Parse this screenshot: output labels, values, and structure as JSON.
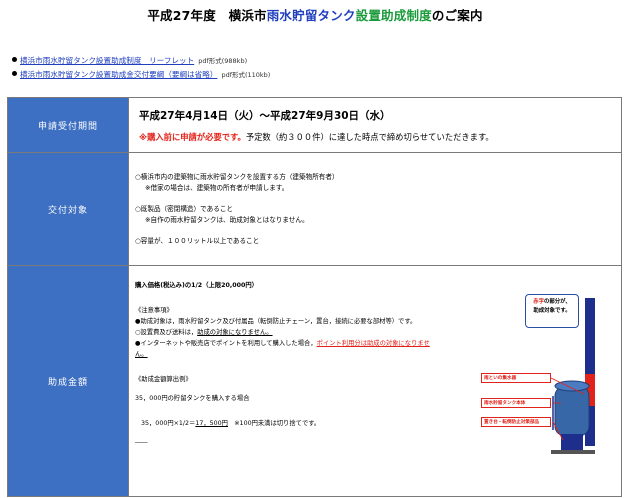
{
  "title": {
    "part1": "平成27年度　横浜市",
    "part2": "雨水貯留タンク",
    "part3": "設置助成制度",
    "part4": "のご案内"
  },
  "links": [
    {
      "text": "横浜市雨水貯留タンク設置助成制度　リーフレット",
      "format": "pdf形式(988kb)"
    },
    {
      "text": "横浜市雨水貯留タンク設置助成金交付要綱（要綱は省略）",
      "format": "pdf形式(110kb)"
    }
  ],
  "rows": {
    "application": {
      "label": "申請受付期間",
      "period": "平成27年4月14日（火）〜平成27年9月30日（水）",
      "note_red": "※購入前に申請が必要です。",
      "note_rest": "予定数（約３００件）に達した時点で締め切らせていただきます。"
    },
    "eligibility": {
      "label": "交付対象",
      "lines": [
        "○横浜市内の建築物に雨水貯留タンクを設置する方（建築物所有者）",
        "※借家の場合は、建築物の所有者が申請します。",
        "○既製品（密閉構造）であること",
        "※自作の雨水貯留タンクは、助成対象とはなりません。",
        "○容量が、１００リットル以上であること"
      ]
    },
    "grant": {
      "label": "助成金額",
      "headline": "購入価格(税込み)の1/2（上限20,000円）",
      "notes_title": "《注意事項》",
      "note1": "●助成対象は，雨水貯留タンク及び付属品（転倒防止チェーン，置台，接続に必要な部材等）です。",
      "note2_a": "○設置費及び送料は，",
      "note2_b": "助成の対象になりません。",
      "note3_a": "●インターネットや販売店でポイントを利用して購入した場合，",
      "note3_b": "ポイント利用分は助成の対象になりませ",
      "note3_c": "ん。",
      "calc_title": "《助成金額算出例》",
      "calc_case": "35，000円の貯留タンクを購入する場合",
      "calc_a": "35，000円×1/2＝",
      "calc_b": "17，500円",
      "calc_c": "　※100円未満は切り捨てです。",
      "calc_d": "――"
    },
    "figure": {
      "callout_red": "赤字",
      "callout_rest1": "の部分が、",
      "callout_rest2": "助成対象です。",
      "label1": "雨といの集水器",
      "label2": "雨水貯留タンク本体",
      "label3": "置き台・転倒防止対策部品"
    }
  }
}
